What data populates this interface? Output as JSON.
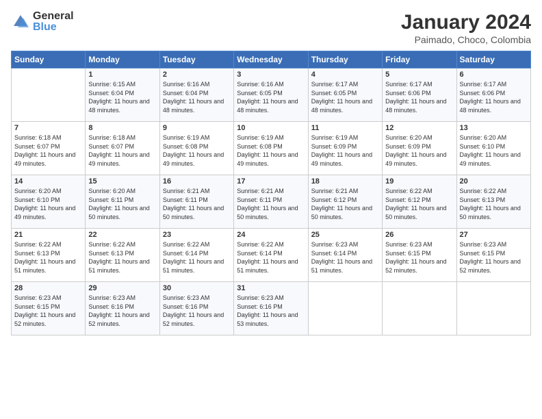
{
  "header": {
    "logo_general": "General",
    "logo_blue": "Blue",
    "month_title": "January 2024",
    "location": "Paimado, Choco, Colombia"
  },
  "weekdays": [
    "Sunday",
    "Monday",
    "Tuesday",
    "Wednesday",
    "Thursday",
    "Friday",
    "Saturday"
  ],
  "weeks": [
    [
      {
        "day": "",
        "sunrise": "",
        "sunset": "",
        "daylight": ""
      },
      {
        "day": "1",
        "sunrise": "Sunrise: 6:15 AM",
        "sunset": "Sunset: 6:04 PM",
        "daylight": "Daylight: 11 hours and 48 minutes."
      },
      {
        "day": "2",
        "sunrise": "Sunrise: 6:16 AM",
        "sunset": "Sunset: 6:04 PM",
        "daylight": "Daylight: 11 hours and 48 minutes."
      },
      {
        "day": "3",
        "sunrise": "Sunrise: 6:16 AM",
        "sunset": "Sunset: 6:05 PM",
        "daylight": "Daylight: 11 hours and 48 minutes."
      },
      {
        "day": "4",
        "sunrise": "Sunrise: 6:17 AM",
        "sunset": "Sunset: 6:05 PM",
        "daylight": "Daylight: 11 hours and 48 minutes."
      },
      {
        "day": "5",
        "sunrise": "Sunrise: 6:17 AM",
        "sunset": "Sunset: 6:06 PM",
        "daylight": "Daylight: 11 hours and 48 minutes."
      },
      {
        "day": "6",
        "sunrise": "Sunrise: 6:17 AM",
        "sunset": "Sunset: 6:06 PM",
        "daylight": "Daylight: 11 hours and 48 minutes."
      }
    ],
    [
      {
        "day": "7",
        "sunrise": "Sunrise: 6:18 AM",
        "sunset": "Sunset: 6:07 PM",
        "daylight": "Daylight: 11 hours and 49 minutes."
      },
      {
        "day": "8",
        "sunrise": "Sunrise: 6:18 AM",
        "sunset": "Sunset: 6:07 PM",
        "daylight": "Daylight: 11 hours and 49 minutes."
      },
      {
        "day": "9",
        "sunrise": "Sunrise: 6:19 AM",
        "sunset": "Sunset: 6:08 PM",
        "daylight": "Daylight: 11 hours and 49 minutes."
      },
      {
        "day": "10",
        "sunrise": "Sunrise: 6:19 AM",
        "sunset": "Sunset: 6:08 PM",
        "daylight": "Daylight: 11 hours and 49 minutes."
      },
      {
        "day": "11",
        "sunrise": "Sunrise: 6:19 AM",
        "sunset": "Sunset: 6:09 PM",
        "daylight": "Daylight: 11 hours and 49 minutes."
      },
      {
        "day": "12",
        "sunrise": "Sunrise: 6:20 AM",
        "sunset": "Sunset: 6:09 PM",
        "daylight": "Daylight: 11 hours and 49 minutes."
      },
      {
        "day": "13",
        "sunrise": "Sunrise: 6:20 AM",
        "sunset": "Sunset: 6:10 PM",
        "daylight": "Daylight: 11 hours and 49 minutes."
      }
    ],
    [
      {
        "day": "14",
        "sunrise": "Sunrise: 6:20 AM",
        "sunset": "Sunset: 6:10 PM",
        "daylight": "Daylight: 11 hours and 49 minutes."
      },
      {
        "day": "15",
        "sunrise": "Sunrise: 6:20 AM",
        "sunset": "Sunset: 6:11 PM",
        "daylight": "Daylight: 11 hours and 50 minutes."
      },
      {
        "day": "16",
        "sunrise": "Sunrise: 6:21 AM",
        "sunset": "Sunset: 6:11 PM",
        "daylight": "Daylight: 11 hours and 50 minutes."
      },
      {
        "day": "17",
        "sunrise": "Sunrise: 6:21 AM",
        "sunset": "Sunset: 6:11 PM",
        "daylight": "Daylight: 11 hours and 50 minutes."
      },
      {
        "day": "18",
        "sunrise": "Sunrise: 6:21 AM",
        "sunset": "Sunset: 6:12 PM",
        "daylight": "Daylight: 11 hours and 50 minutes."
      },
      {
        "day": "19",
        "sunrise": "Sunrise: 6:22 AM",
        "sunset": "Sunset: 6:12 PM",
        "daylight": "Daylight: 11 hours and 50 minutes."
      },
      {
        "day": "20",
        "sunrise": "Sunrise: 6:22 AM",
        "sunset": "Sunset: 6:13 PM",
        "daylight": "Daylight: 11 hours and 50 minutes."
      }
    ],
    [
      {
        "day": "21",
        "sunrise": "Sunrise: 6:22 AM",
        "sunset": "Sunset: 6:13 PM",
        "daylight": "Daylight: 11 hours and 51 minutes."
      },
      {
        "day": "22",
        "sunrise": "Sunrise: 6:22 AM",
        "sunset": "Sunset: 6:13 PM",
        "daylight": "Daylight: 11 hours and 51 minutes."
      },
      {
        "day": "23",
        "sunrise": "Sunrise: 6:22 AM",
        "sunset": "Sunset: 6:14 PM",
        "daylight": "Daylight: 11 hours and 51 minutes."
      },
      {
        "day": "24",
        "sunrise": "Sunrise: 6:22 AM",
        "sunset": "Sunset: 6:14 PM",
        "daylight": "Daylight: 11 hours and 51 minutes."
      },
      {
        "day": "25",
        "sunrise": "Sunrise: 6:23 AM",
        "sunset": "Sunset: 6:14 PM",
        "daylight": "Daylight: 11 hours and 51 minutes."
      },
      {
        "day": "26",
        "sunrise": "Sunrise: 6:23 AM",
        "sunset": "Sunset: 6:15 PM",
        "daylight": "Daylight: 11 hours and 52 minutes."
      },
      {
        "day": "27",
        "sunrise": "Sunrise: 6:23 AM",
        "sunset": "Sunset: 6:15 PM",
        "daylight": "Daylight: 11 hours and 52 minutes."
      }
    ],
    [
      {
        "day": "28",
        "sunrise": "Sunrise: 6:23 AM",
        "sunset": "Sunset: 6:15 PM",
        "daylight": "Daylight: 11 hours and 52 minutes."
      },
      {
        "day": "29",
        "sunrise": "Sunrise: 6:23 AM",
        "sunset": "Sunset: 6:16 PM",
        "daylight": "Daylight: 11 hours and 52 minutes."
      },
      {
        "day": "30",
        "sunrise": "Sunrise: 6:23 AM",
        "sunset": "Sunset: 6:16 PM",
        "daylight": "Daylight: 11 hours and 52 minutes."
      },
      {
        "day": "31",
        "sunrise": "Sunrise: 6:23 AM",
        "sunset": "Sunset: 6:16 PM",
        "daylight": "Daylight: 11 hours and 53 minutes."
      },
      {
        "day": "",
        "sunrise": "",
        "sunset": "",
        "daylight": ""
      },
      {
        "day": "",
        "sunrise": "",
        "sunset": "",
        "daylight": ""
      },
      {
        "day": "",
        "sunrise": "",
        "sunset": "",
        "daylight": ""
      }
    ]
  ]
}
